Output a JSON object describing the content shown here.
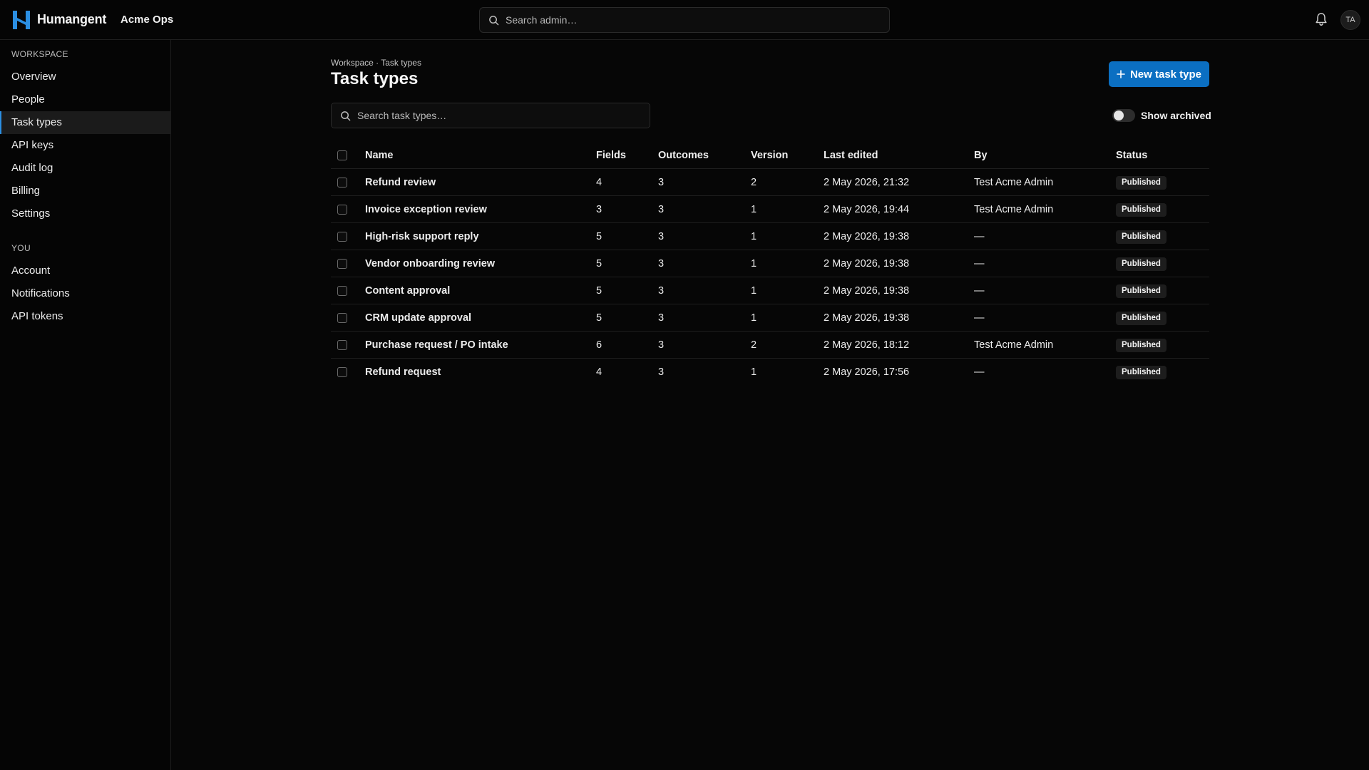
{
  "app": {
    "brand": "Humangent",
    "org": "Acme Ops"
  },
  "header": {
    "search_placeholder": "Search admin…",
    "avatar_initials": "TA"
  },
  "sidebar": {
    "workspace_label": "WORKSPACE",
    "workspace_items": [
      {
        "label": "Overview"
      },
      {
        "label": "People"
      },
      {
        "label": "Task types",
        "active": true
      },
      {
        "label": "API keys"
      },
      {
        "label": "Audit log"
      },
      {
        "label": "Billing"
      },
      {
        "label": "Settings"
      }
    ],
    "you_label": "YOU",
    "you_items": [
      {
        "label": "Account"
      },
      {
        "label": "Notifications"
      },
      {
        "label": "API tokens"
      }
    ]
  },
  "main": {
    "breadcrumb": "Workspace · Task types",
    "title": "Task types",
    "new_button_label": "New task type",
    "search_placeholder": "Search task types…",
    "show_archived_label": "Show archived",
    "show_archived": false
  },
  "table": {
    "columns": {
      "name": "Name",
      "fields": "Fields",
      "outcomes": "Outcomes",
      "version": "Version",
      "last_edited": "Last edited",
      "by": "By",
      "status": "Status"
    },
    "rows": [
      {
        "name": "Refund review",
        "fields": "4",
        "outcomes": "3",
        "version": "2",
        "last_edited": "2 May 2026, 21:32",
        "by": "Test Acme Admin",
        "status": "Published"
      },
      {
        "name": "Invoice exception review",
        "fields": "3",
        "outcomes": "3",
        "version": "1",
        "last_edited": "2 May 2026, 19:44",
        "by": "Test Acme Admin",
        "status": "Published"
      },
      {
        "name": "High-risk support reply",
        "fields": "5",
        "outcomes": "3",
        "version": "1",
        "last_edited": "2 May 2026, 19:38",
        "by": "—",
        "status": "Published"
      },
      {
        "name": "Vendor onboarding review",
        "fields": "5",
        "outcomes": "3",
        "version": "1",
        "last_edited": "2 May 2026, 19:38",
        "by": "—",
        "status": "Published"
      },
      {
        "name": "Content approval",
        "fields": "5",
        "outcomes": "3",
        "version": "1",
        "last_edited": "2 May 2026, 19:38",
        "by": "—",
        "status": "Published"
      },
      {
        "name": "CRM update approval",
        "fields": "5",
        "outcomes": "3",
        "version": "1",
        "last_edited": "2 May 2026, 19:38",
        "by": "—",
        "status": "Published"
      },
      {
        "name": "Purchase request / PO intake",
        "fields": "6",
        "outcomes": "3",
        "version": "2",
        "last_edited": "2 May 2026, 18:12",
        "by": "Test Acme Admin",
        "status": "Published"
      },
      {
        "name": "Refund request",
        "fields": "4",
        "outcomes": "3",
        "version": "1",
        "last_edited": "2 May 2026, 17:56",
        "by": "—",
        "status": "Published"
      }
    ]
  },
  "icons": {
    "logo": "humangent-logo",
    "search": "search-icon",
    "bell": "bell-icon",
    "plus": "plus-icon"
  },
  "colors": {
    "accent": "#0b6fc2",
    "logo": "#2b8fe3",
    "background": "#060606"
  }
}
